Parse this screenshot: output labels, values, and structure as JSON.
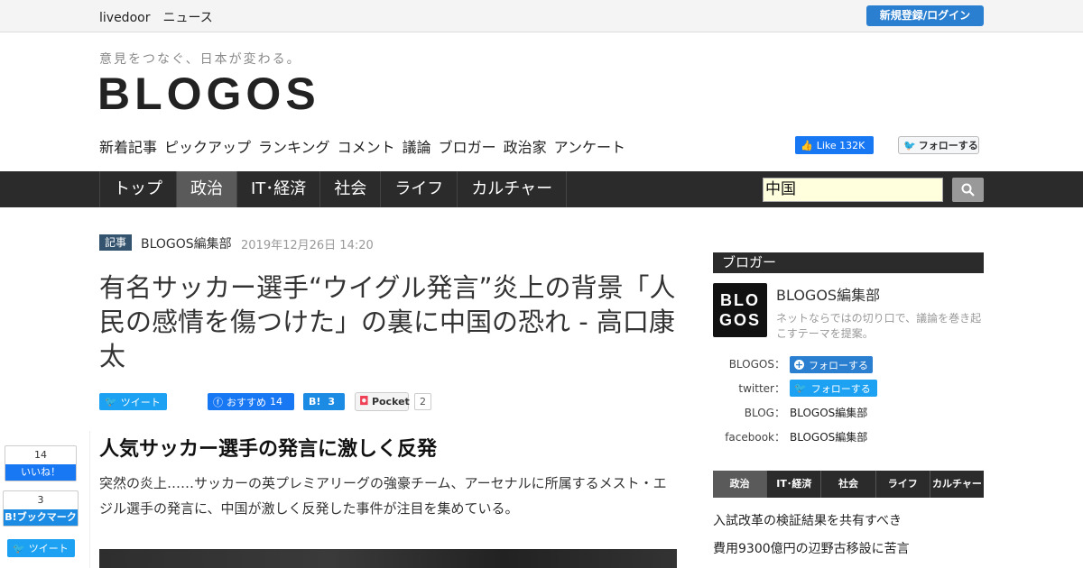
{
  "topbar": {
    "brand": "livedoor　ニュース",
    "login_label": "新規登録/ログイン"
  },
  "header": {
    "tagline": "意見をつなぐ、日本が変わる。",
    "logo": "BLOGOS",
    "subnav": [
      "新着記事",
      "ピックアップ",
      "ランキング",
      "コメント",
      "議論",
      "ブロガー",
      "政治家",
      "アンケート"
    ],
    "fb_like_label": "Like 132K",
    "tw_follow_label": "フォローする"
  },
  "mainnav": {
    "items": [
      "トップ",
      "政治",
      "IT･経済",
      "社会",
      "ライフ",
      "カルチャー"
    ],
    "active_index": 1,
    "search_value": "中国"
  },
  "article": {
    "badge": "記事",
    "author": "BLOGOS編集部",
    "date": "2019年12月26日 14:20",
    "title": "有名サッカー選手“ウイグル発言”炎上の背景「人民の感情を傷つけた」の裏に中国の恐れ - 高口康太",
    "share": {
      "tweet_label": "ツイート",
      "fb_label": "おすすめ",
      "fb_count": "14",
      "hatena_label": "B!",
      "hatena_count": "3",
      "pocket_label": "Pocket",
      "pocket_count": "2"
    },
    "heading": "人気サッカー選手の発言に激しく反発",
    "lead": "突然の炎上……サッカーの英プレミアリーグの強豪チーム、アーセナルに所属するメスト・エジル選手の発言に、中国が激しく反発した事件が注目を集めている。"
  },
  "float_share": {
    "fb_count": "14",
    "fb_label": "いいね！",
    "hatena_count": "3",
    "hatena_label": "B!ブックマーク",
    "tweet_label": "ツイート"
  },
  "sidebar": {
    "heading": "ブロガー",
    "avatar_text": "BLO GOS",
    "name": "BLOGOS編集部",
    "description": "ネットならではの切り口で、議論を巻き起こすテーマを提案。",
    "rows": [
      {
        "label": "BLOGOS：",
        "value": "フォローする"
      },
      {
        "label": "twitter：",
        "value": "フォローする"
      },
      {
        "label": "BLOG：",
        "value": "BLOGOS編集部"
      },
      {
        "label": "facebook：",
        "value": "BLOGOS編集部"
      }
    ],
    "tabs": [
      "政治",
      "IT･経済",
      "社会",
      "ライフ",
      "カルチャー"
    ],
    "links": [
      "入試改革の検証結果を共有すべき",
      "費用9300億円の辺野古移設に苦言"
    ]
  },
  "colors": {
    "accent_blue": "#2a7fd0",
    "nav_dark": "#2b2b2b",
    "nav_active": "#5a5a5a",
    "badge": "#33536e"
  }
}
